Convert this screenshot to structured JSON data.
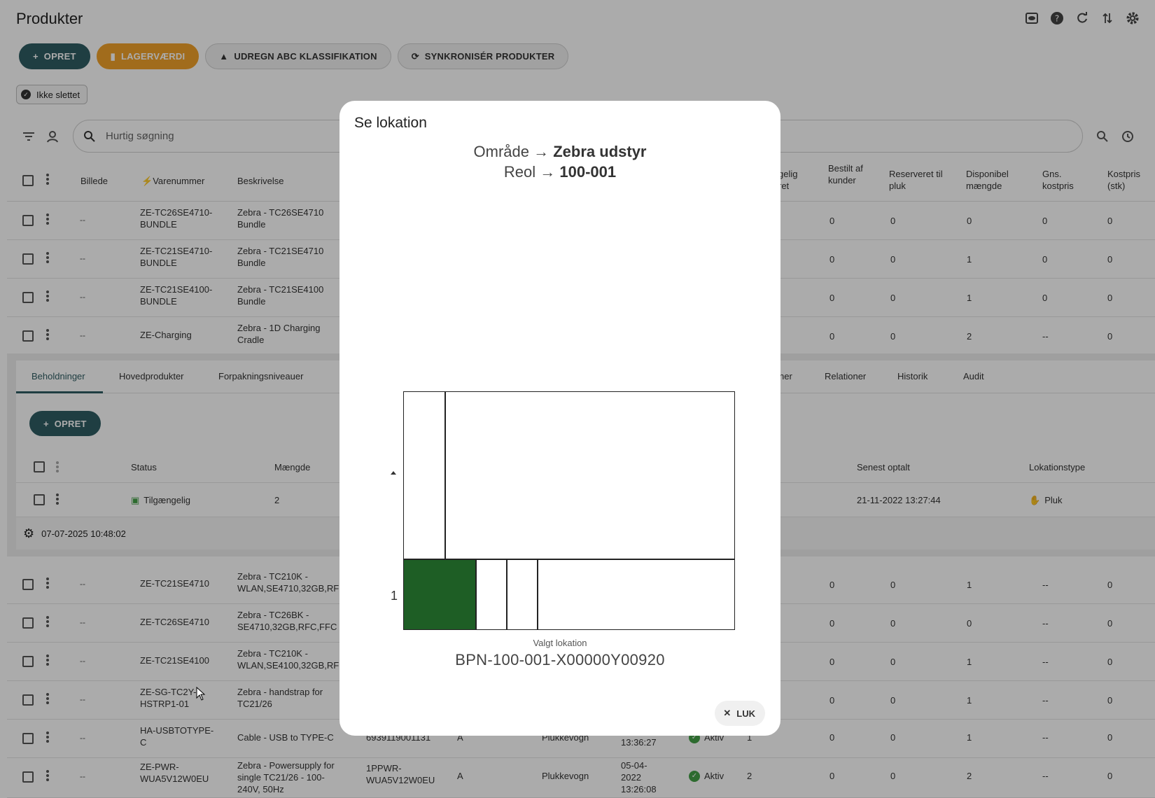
{
  "page": {
    "title": "Produkter"
  },
  "toolbar": {
    "create": "OPRET",
    "stock_value": "LAGERVÆRDI",
    "abc": "UDREGN ABC KLASSIFIKATION",
    "sync": "SYNKRONISÉR PRODUKTER"
  },
  "filter_chip": "Ikke slettet",
  "search": {
    "placeholder": "Hurtig søgning"
  },
  "table": {
    "headers": {
      "image": "Billede",
      "sku": "Varenummer",
      "description": "Beskrivelse",
      "available_partial_1": "gelig",
      "available_partial_2": "ret",
      "ordered_by_customers": "Bestilt af kunder",
      "reserved_for_pick": "Reserveret til pluk",
      "disposable_qty": "Disponibel mængde",
      "avg_cost": "Gns. kostpris",
      "cost_pcs": "Kostpris (stk)"
    },
    "broken_image": "--",
    "rows_top": [
      {
        "sku": "ZE-TC26SE4710-BUNDLE",
        "desc": "Zebra - TC26SE4710 Bundle",
        "ordered": "0",
        "reserved": "0",
        "disposable": "0",
        "avg": "0",
        "cost": "0"
      },
      {
        "sku": "ZE-TC21SE4710-BUNDLE",
        "desc": "Zebra - TC21SE4710 Bundle",
        "ordered": "0",
        "reserved": "0",
        "disposable": "1",
        "avg": "0",
        "cost": "0"
      },
      {
        "sku": "ZE-TC21SE4100-BUNDLE",
        "desc": "Zebra - TC21SE4100 Bundle",
        "ordered": "0",
        "reserved": "0",
        "disposable": "1",
        "avg": "0",
        "cost": "0"
      },
      {
        "sku": "ZE-Charging",
        "desc": "Zebra - 1D Charging Cradle",
        "ordered": "0",
        "reserved": "0",
        "disposable": "2",
        "avg": "--",
        "cost": "0"
      }
    ],
    "rows_bottom": [
      {
        "sku": "ZE-TC21SE4710",
        "desc": "Zebra - TC210K - WLAN,SE4710,32GB,RF",
        "ordered": "0",
        "reserved": "0",
        "disposable": "1",
        "avg": "--",
        "cost": "0"
      },
      {
        "sku": "ZE-TC26SE4710",
        "desc": "Zebra - TC26BK - SE4710,32GB,RFC,FFC",
        "ordered": "0",
        "reserved": "0",
        "disposable": "0",
        "avg": "--",
        "cost": "0"
      },
      {
        "sku": "ZE-TC21SE4100",
        "desc": "Zebra - TC210K - WLAN,SE4100,32GB,RF",
        "ordered": "0",
        "reserved": "0",
        "disposable": "1",
        "avg": "--",
        "cost": "0"
      },
      {
        "sku": "ZE-SG-TC2Y-HSTRP1-01",
        "desc": "Zebra - handstrap for TC21/26",
        "ordered": "0",
        "reserved": "0",
        "disposable": "1",
        "avg": "--",
        "cost": "0"
      },
      {
        "sku": "HA-USBTOTYPE-C",
        "desc": "Cable - USB to TYPE-C",
        "ean": "6939119001131",
        "abc": "A",
        "location": "Plukkevogn",
        "date": "2022 13:36:27",
        "status": "Aktiv",
        "available": "1",
        "ordered": "0",
        "reserved": "0",
        "disposable": "1",
        "avg": "--",
        "cost": "0"
      },
      {
        "sku": "ZE-PWR-WUA5V12W0EU",
        "desc": "Zebra - Powersupply for single TC21/26 - 100-240V, 50Hz",
        "ean": "1PPWR-WUA5V12W0EU",
        "abc": "A",
        "location": "Plukkevogn",
        "date": "05-04-2022 13:26:08",
        "status": "Aktiv",
        "available": "2",
        "ordered": "0",
        "reserved": "0",
        "disposable": "2",
        "avg": "--",
        "cost": "0"
      }
    ]
  },
  "detail_panel": {
    "tabs": [
      "Beholdninger",
      "Hovedprodukter",
      "Forpakningsniveauer",
      "ner",
      "Relationer",
      "Historik",
      "Audit"
    ],
    "create": "OPRET",
    "headers": {
      "status": "Status",
      "qty": "Mængde",
      "last_counted": "Senest optalt",
      "location_type": "Lokationstype"
    },
    "row": {
      "status": "Tilgængelig",
      "qty": "2",
      "last_counted": "21-11-2022 13:27:44",
      "location_type": "Pluk"
    },
    "footer_time": "07-07-2025 10:48:02"
  },
  "dialog": {
    "title": "Se lokation",
    "area_label": "Område",
    "area_value": "Zebra udstyr",
    "shelf_label": "Reol",
    "shelf_value": "100-001",
    "arrow": "→",
    "level_label": "1",
    "selected_caption": "Valgt lokation",
    "selected_value": "BPN-100-001-X00000Y00920",
    "close": "LUK",
    "highlight_color": "#1e5e25"
  }
}
